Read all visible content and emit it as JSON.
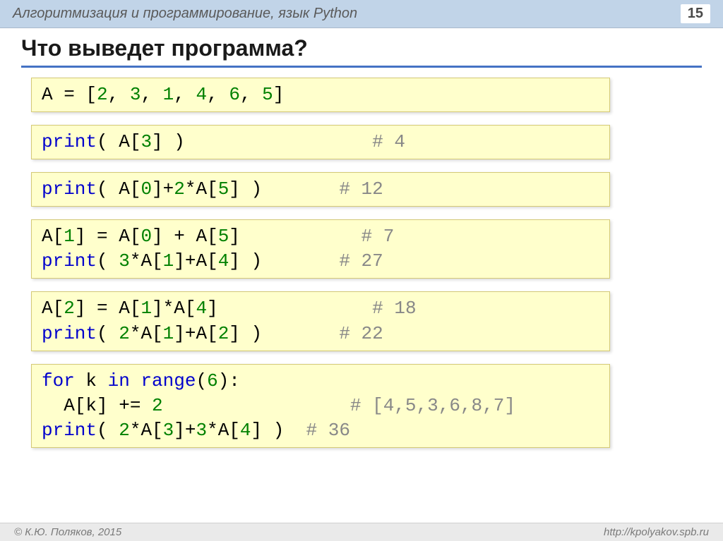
{
  "header": {
    "title": "Алгоритмизация и программирование, язык Python",
    "page": "15"
  },
  "slide_title": "Что выведет программа?",
  "box1": {
    "line1_a": "A = [",
    "line1_b": "2",
    "line1_c": ", ",
    "line1_d": "3",
    "line1_e": ", ",
    "line1_f": "1",
    "line1_g": ", ",
    "line1_h": "4",
    "line1_i": ", ",
    "line1_j": "6",
    "line1_k": ", ",
    "line1_l": "5",
    "line1_m": "]"
  },
  "box2": {
    "code_a": "print",
    "code_b": "( A[",
    "code_c": "3",
    "code_d": "] )",
    "comment": "# 4"
  },
  "box3": {
    "code_a": "print",
    "code_b": "( A[",
    "code_c": "0",
    "code_d": "]+",
    "code_e": "2",
    "code_f": "*A[",
    "code_g": "5",
    "code_h": "] )",
    "comment": "# 12"
  },
  "box4": {
    "l1_a": "A[",
    "l1_b": "1",
    "l1_c": "] = A[",
    "l1_d": "0",
    "l1_e": "] + A[",
    "l1_f": "5",
    "l1_g": "]",
    "c1": "# 7",
    "l2_a": "print",
    "l2_b": "( ",
    "l2_c": "3",
    "l2_d": "*A[",
    "l2_e": "1",
    "l2_f": "]+A[",
    "l2_g": "4",
    "l2_h": "] )",
    "c2": "# 27"
  },
  "box5": {
    "l1_a": "A[",
    "l1_b": "2",
    "l1_c": "] = A[",
    "l1_d": "1",
    "l1_e": "]*A[",
    "l1_f": "4",
    "l1_g": "]",
    "c1": "# 18",
    "l2_a": "print",
    "l2_b": "( ",
    "l2_c": "2",
    "l2_d": "*A[",
    "l2_e": "1",
    "l2_f": "]+A[",
    "l2_g": "2",
    "l2_h": "] )",
    "c2": "# 22"
  },
  "box6": {
    "l1_a": "for",
    "l1_b": " k ",
    "l1_c": "in",
    "l1_d": " ",
    "l1_e": "range",
    "l1_f": "(",
    "l1_g": "6",
    "l1_h": "):",
    "l2_a": "  A[k] += ",
    "l2_b": "2",
    "c2": "# [4,5,3,6,8,7]",
    "l3_a": "print",
    "l3_b": "( ",
    "l3_c": "2",
    "l3_d": "*A[",
    "l3_e": "3",
    "l3_f": "]+",
    "l3_g": "3",
    "l3_h": "*A[",
    "l3_i": "4",
    "l3_j": "] )",
    "c3": "# 36"
  },
  "footer": {
    "left": "© К.Ю. Поляков, 2015",
    "right": "http://kpolyakov.spb.ru"
  },
  "gaps": {
    "g33": "                 ",
    "g30": "              ",
    "g27": "           ",
    "g23": "       ",
    "g21": "     ",
    "g19": "   ",
    "g17": "  ",
    "g15": " "
  }
}
